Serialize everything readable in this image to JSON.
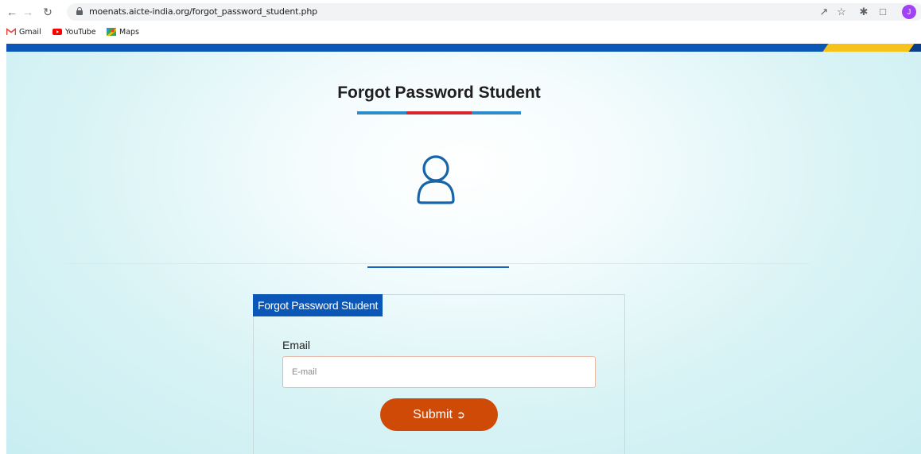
{
  "browser": {
    "url": "moenats.aicte-india.org/forgot_password_student.php",
    "profile_initial": "J",
    "bookmarks": [
      {
        "label": "Gmail",
        "icon": "gmail-icon"
      },
      {
        "label": "YouTube",
        "icon": "youtube-icon"
      },
      {
        "label": "Maps",
        "icon": "maps-icon"
      }
    ]
  },
  "page": {
    "title": "Forgot Password Student",
    "panel_tab": "Forgot Password Student",
    "email_label": "Email",
    "email_placeholder": "E-mail",
    "email_value": "",
    "submit_label": "Submit",
    "submit_icon": "sign-in-icon"
  },
  "colors": {
    "brand_blue": "#0b57b7",
    "accent_yellow": "#f7c21a",
    "underline_red": "#d7262b",
    "submit_orange": "#cf4a07"
  }
}
